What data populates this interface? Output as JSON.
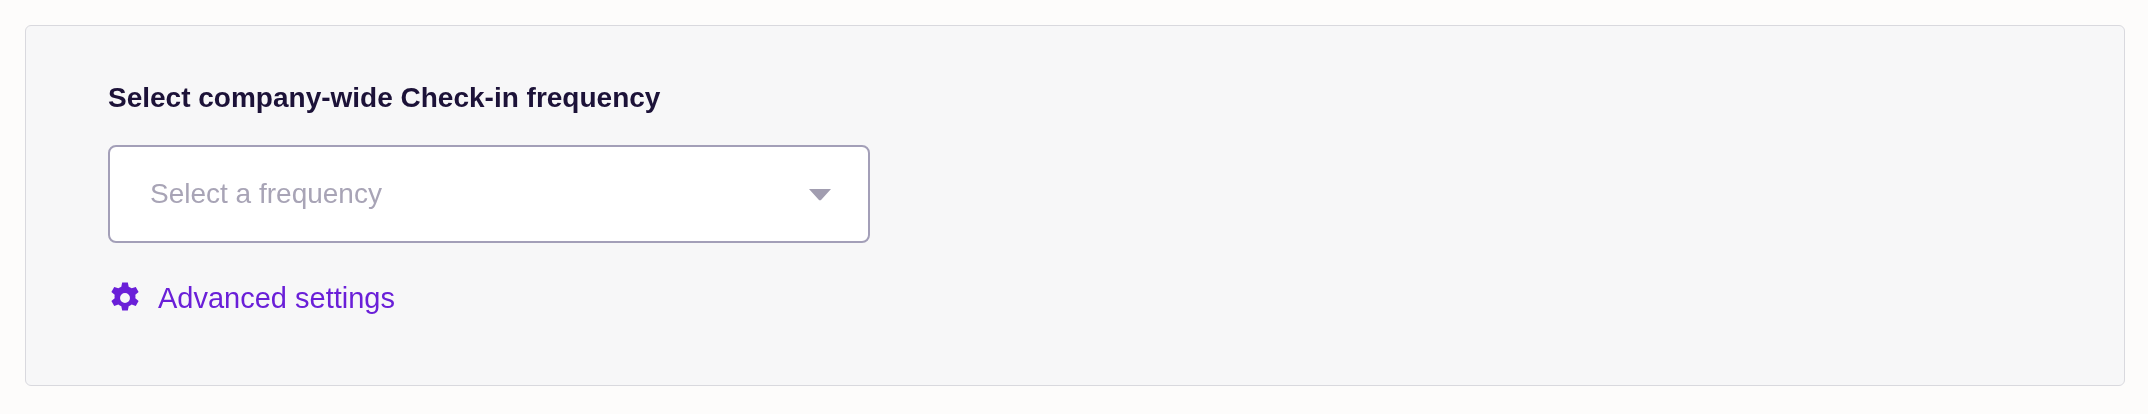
{
  "title": "Select company-wide Check-in frequency",
  "frequency_dropdown": {
    "placeholder": "Select a frequency"
  },
  "advanced_link": {
    "label": "Advanced settings"
  }
}
